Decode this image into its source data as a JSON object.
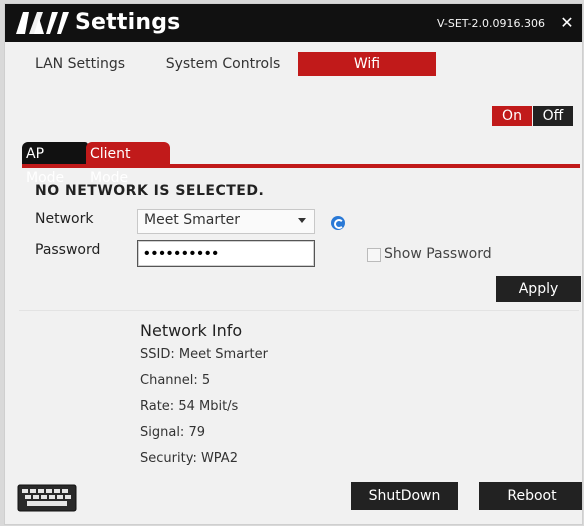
{
  "window": {
    "title": "Settings",
    "version": "V-SET-2.0.0916.306",
    "close_label": "✕"
  },
  "nav": {
    "items": [
      "LAN Settings",
      "System Controls",
      "Wifi"
    ],
    "active": "Wifi"
  },
  "wifi_toggle": {
    "on_label": "On",
    "off_label": "Off",
    "selected": "On"
  },
  "mode_tabs": {
    "items": [
      "AP Mode",
      "Client Mode"
    ],
    "active": "AP Mode"
  },
  "form": {
    "status": "NO NETWORK IS SELECTED.",
    "network_label": "Network",
    "network_value": "Meet Smarter",
    "password_label": "Password",
    "password_value": "••••••••••",
    "show_password_label": "Show Password",
    "apply_label": "Apply"
  },
  "network_info": {
    "title": "Network Info",
    "ssid": "SSID: Meet Smarter",
    "channel": "Channel: 5",
    "rate": "Rate: 54 Mbit/s",
    "signal": "Signal: 79",
    "security": "Security: WPA2"
  },
  "footer": {
    "shutdown_label": "ShutDown",
    "reboot_label": "Reboot"
  },
  "colors": {
    "accent_red": "#c11a1a",
    "dark": "#111111",
    "refresh_blue": "#2a79d6"
  },
  "icons": {
    "logo": "va-logo-icon",
    "refresh": "refresh-icon",
    "keyboard": "keyboard-icon",
    "close": "close-icon"
  }
}
